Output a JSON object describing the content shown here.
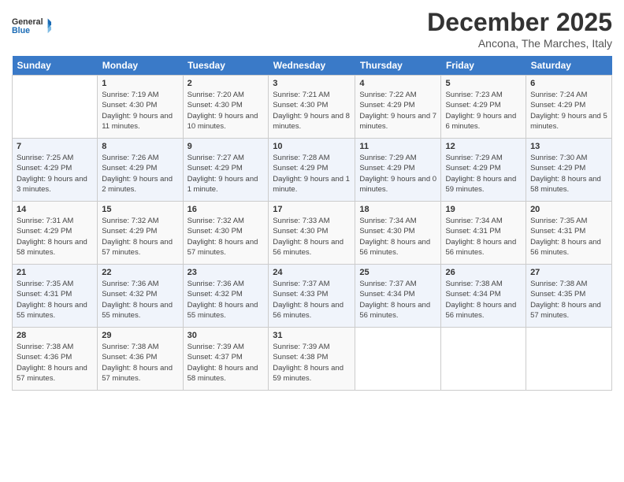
{
  "logo": {
    "text_general": "General",
    "text_blue": "Blue"
  },
  "header": {
    "month_title": "December 2025",
    "subtitle": "Ancona, The Marches, Italy"
  },
  "weekdays": [
    "Sunday",
    "Monday",
    "Tuesday",
    "Wednesday",
    "Thursday",
    "Friday",
    "Saturday"
  ],
  "weeks": [
    [
      {
        "day": "",
        "sunrise": "",
        "sunset": "",
        "daylight": ""
      },
      {
        "day": "1",
        "sunrise": "Sunrise: 7:19 AM",
        "sunset": "Sunset: 4:30 PM",
        "daylight": "Daylight: 9 hours and 11 minutes."
      },
      {
        "day": "2",
        "sunrise": "Sunrise: 7:20 AM",
        "sunset": "Sunset: 4:30 PM",
        "daylight": "Daylight: 9 hours and 10 minutes."
      },
      {
        "day": "3",
        "sunrise": "Sunrise: 7:21 AM",
        "sunset": "Sunset: 4:30 PM",
        "daylight": "Daylight: 9 hours and 8 minutes."
      },
      {
        "day": "4",
        "sunrise": "Sunrise: 7:22 AM",
        "sunset": "Sunset: 4:29 PM",
        "daylight": "Daylight: 9 hours and 7 minutes."
      },
      {
        "day": "5",
        "sunrise": "Sunrise: 7:23 AM",
        "sunset": "Sunset: 4:29 PM",
        "daylight": "Daylight: 9 hours and 6 minutes."
      },
      {
        "day": "6",
        "sunrise": "Sunrise: 7:24 AM",
        "sunset": "Sunset: 4:29 PM",
        "daylight": "Daylight: 9 hours and 5 minutes."
      }
    ],
    [
      {
        "day": "7",
        "sunrise": "Sunrise: 7:25 AM",
        "sunset": "Sunset: 4:29 PM",
        "daylight": "Daylight: 9 hours and 3 minutes."
      },
      {
        "day": "8",
        "sunrise": "Sunrise: 7:26 AM",
        "sunset": "Sunset: 4:29 PM",
        "daylight": "Daylight: 9 hours and 2 minutes."
      },
      {
        "day": "9",
        "sunrise": "Sunrise: 7:27 AM",
        "sunset": "Sunset: 4:29 PM",
        "daylight": "Daylight: 9 hours and 1 minute."
      },
      {
        "day": "10",
        "sunrise": "Sunrise: 7:28 AM",
        "sunset": "Sunset: 4:29 PM",
        "daylight": "Daylight: 9 hours and 1 minute."
      },
      {
        "day": "11",
        "sunrise": "Sunrise: 7:29 AM",
        "sunset": "Sunset: 4:29 PM",
        "daylight": "Daylight: 9 hours and 0 minutes."
      },
      {
        "day": "12",
        "sunrise": "Sunrise: 7:29 AM",
        "sunset": "Sunset: 4:29 PM",
        "daylight": "Daylight: 8 hours and 59 minutes."
      },
      {
        "day": "13",
        "sunrise": "Sunrise: 7:30 AM",
        "sunset": "Sunset: 4:29 PM",
        "daylight": "Daylight: 8 hours and 58 minutes."
      }
    ],
    [
      {
        "day": "14",
        "sunrise": "Sunrise: 7:31 AM",
        "sunset": "Sunset: 4:29 PM",
        "daylight": "Daylight: 8 hours and 58 minutes."
      },
      {
        "day": "15",
        "sunrise": "Sunrise: 7:32 AM",
        "sunset": "Sunset: 4:29 PM",
        "daylight": "Daylight: 8 hours and 57 minutes."
      },
      {
        "day": "16",
        "sunrise": "Sunrise: 7:32 AM",
        "sunset": "Sunset: 4:30 PM",
        "daylight": "Daylight: 8 hours and 57 minutes."
      },
      {
        "day": "17",
        "sunrise": "Sunrise: 7:33 AM",
        "sunset": "Sunset: 4:30 PM",
        "daylight": "Daylight: 8 hours and 56 minutes."
      },
      {
        "day": "18",
        "sunrise": "Sunrise: 7:34 AM",
        "sunset": "Sunset: 4:30 PM",
        "daylight": "Daylight: 8 hours and 56 minutes."
      },
      {
        "day": "19",
        "sunrise": "Sunrise: 7:34 AM",
        "sunset": "Sunset: 4:31 PM",
        "daylight": "Daylight: 8 hours and 56 minutes."
      },
      {
        "day": "20",
        "sunrise": "Sunrise: 7:35 AM",
        "sunset": "Sunset: 4:31 PM",
        "daylight": "Daylight: 8 hours and 56 minutes."
      }
    ],
    [
      {
        "day": "21",
        "sunrise": "Sunrise: 7:35 AM",
        "sunset": "Sunset: 4:31 PM",
        "daylight": "Daylight: 8 hours and 55 minutes."
      },
      {
        "day": "22",
        "sunrise": "Sunrise: 7:36 AM",
        "sunset": "Sunset: 4:32 PM",
        "daylight": "Daylight: 8 hours and 55 minutes."
      },
      {
        "day": "23",
        "sunrise": "Sunrise: 7:36 AM",
        "sunset": "Sunset: 4:32 PM",
        "daylight": "Daylight: 8 hours and 55 minutes."
      },
      {
        "day": "24",
        "sunrise": "Sunrise: 7:37 AM",
        "sunset": "Sunset: 4:33 PM",
        "daylight": "Daylight: 8 hours and 56 minutes."
      },
      {
        "day": "25",
        "sunrise": "Sunrise: 7:37 AM",
        "sunset": "Sunset: 4:34 PM",
        "daylight": "Daylight: 8 hours and 56 minutes."
      },
      {
        "day": "26",
        "sunrise": "Sunrise: 7:38 AM",
        "sunset": "Sunset: 4:34 PM",
        "daylight": "Daylight: 8 hours and 56 minutes."
      },
      {
        "day": "27",
        "sunrise": "Sunrise: 7:38 AM",
        "sunset": "Sunset: 4:35 PM",
        "daylight": "Daylight: 8 hours and 57 minutes."
      }
    ],
    [
      {
        "day": "28",
        "sunrise": "Sunrise: 7:38 AM",
        "sunset": "Sunset: 4:36 PM",
        "daylight": "Daylight: 8 hours and 57 minutes."
      },
      {
        "day": "29",
        "sunrise": "Sunrise: 7:38 AM",
        "sunset": "Sunset: 4:36 PM",
        "daylight": "Daylight: 8 hours and 57 minutes."
      },
      {
        "day": "30",
        "sunrise": "Sunrise: 7:39 AM",
        "sunset": "Sunset: 4:37 PM",
        "daylight": "Daylight: 8 hours and 58 minutes."
      },
      {
        "day": "31",
        "sunrise": "Sunrise: 7:39 AM",
        "sunset": "Sunset: 4:38 PM",
        "daylight": "Daylight: 8 hours and 59 minutes."
      },
      {
        "day": "",
        "sunrise": "",
        "sunset": "",
        "daylight": ""
      },
      {
        "day": "",
        "sunrise": "",
        "sunset": "",
        "daylight": ""
      },
      {
        "day": "",
        "sunrise": "",
        "sunset": "",
        "daylight": ""
      }
    ]
  ]
}
